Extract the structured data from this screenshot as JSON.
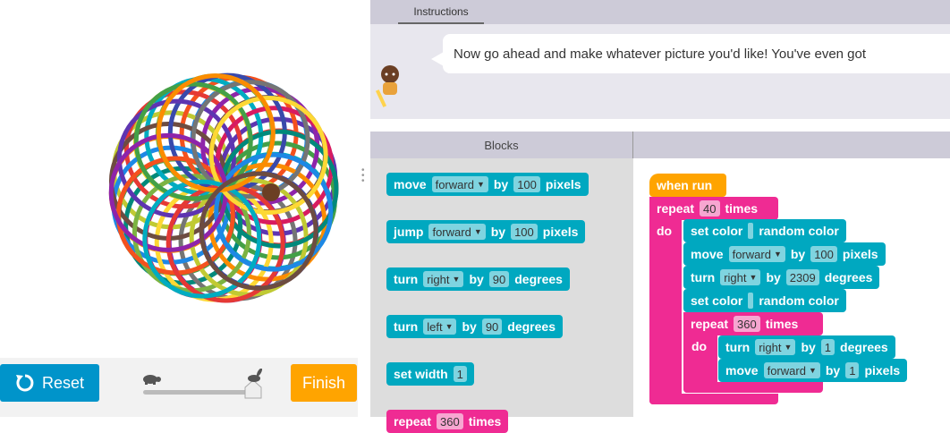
{
  "instructions": {
    "tab_label": "Instructions",
    "message": "Now go ahead and make whatever picture you'd like! You've even got"
  },
  "blocks_header": {
    "label": "Blocks"
  },
  "controls": {
    "reset_label": "Reset",
    "finish_label": "Finish"
  },
  "toolbox": [
    {
      "pre": "move",
      "field": "forward",
      "mid": "by",
      "value": "100",
      "post": "pixels"
    },
    {
      "pre": "jump",
      "field": "forward",
      "mid": "by",
      "value": "100",
      "post": "pixels"
    },
    {
      "pre": "turn",
      "field": "right",
      "mid": "by",
      "value": "90",
      "post": "degrees"
    },
    {
      "pre": "turn",
      "field": "left",
      "mid": "by",
      "value": "90",
      "post": "degrees"
    },
    {
      "pre": "set width",
      "value": "1"
    },
    {
      "pre": "repeat",
      "value": "360",
      "post": "times"
    }
  ],
  "workspace": {
    "when_run": "when run",
    "outer_repeat": {
      "pre": "repeat",
      "value": "40",
      "post": "times",
      "do": "do"
    },
    "set_color_1": {
      "pre": "set color",
      "value": "random color"
    },
    "move_1": {
      "pre": "move",
      "field": "forward",
      "mid": "by",
      "value": "100",
      "post": "pixels"
    },
    "turn_1": {
      "pre": "turn",
      "field": "right",
      "mid": "by",
      "value": "2309",
      "post": "degrees"
    },
    "set_color_2": {
      "pre": "set color",
      "value": "random color"
    },
    "inner_repeat": {
      "pre": "repeat",
      "value": "360",
      "post": "times",
      "do": "do"
    },
    "turn_2": {
      "pre": "turn",
      "field": "right",
      "mid": "by",
      "value": "1",
      "post": "degrees"
    },
    "move_2": {
      "pre": "move",
      "field": "forward",
      "mid": "by",
      "value": "1",
      "post": "pixels"
    }
  },
  "colors": {
    "teal_block": "#00a8c0",
    "pink_block": "#ef2b93",
    "orange_block": "#ffa400",
    "reset_button": "#0094ca",
    "finish_button": "#ffa400",
    "header_bg": "#cdcbd8"
  },
  "icons": [
    "reset-icon",
    "turtle-icon",
    "rabbit-icon",
    "artist-avatar-icon",
    "drag-grip-icon"
  ]
}
